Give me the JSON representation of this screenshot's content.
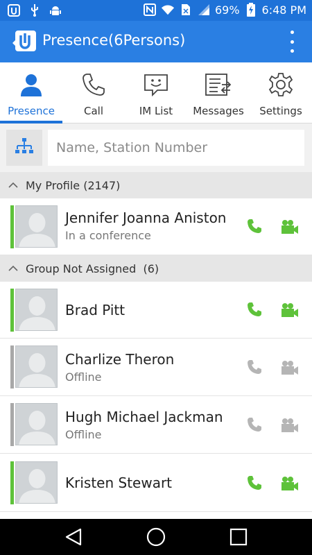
{
  "status_bar": {
    "battery": "69%",
    "time": "6:48 PM",
    "icons": [
      "app-notification-icon",
      "usb-icon",
      "android-debug-icon",
      "nfc-icon",
      "wifi-icon",
      "sim-icon",
      "signal-icon",
      "battery-charging-icon"
    ]
  },
  "app_bar": {
    "title": "Presence(6Persons)",
    "logo_icon": "app-logo-icon",
    "menu_icon": "overflow-menu-icon"
  },
  "tabs": [
    {
      "label": "Presence",
      "icon": "person-icon",
      "active": true
    },
    {
      "label": "Call",
      "icon": "phone-icon",
      "active": false
    },
    {
      "label": "IM List",
      "icon": "chat-icon",
      "active": false
    },
    {
      "label": "Messages",
      "icon": "messages-icon",
      "active": false
    },
    {
      "label": "Settings",
      "icon": "gear-icon",
      "active": false
    }
  ],
  "search": {
    "placeholder": "Name, Station Number",
    "value": "",
    "org_icon": "org-chart-icon"
  },
  "sections": [
    {
      "label": "My Profile (2147)",
      "contacts": [
        {
          "name": "Jennifer Joanna Aniston",
          "status": "In a conference",
          "online": true
        }
      ]
    },
    {
      "label": "Group Not Assigned  (6)",
      "contacts": [
        {
          "name": "Brad Pitt",
          "status": "",
          "online": true
        },
        {
          "name": "Charlize Theron",
          "status": "Offline",
          "online": false
        },
        {
          "name": "Hugh Michael Jackman",
          "status": "Offline",
          "online": false
        },
        {
          "name": "Kristen Stewart",
          "status": "",
          "online": true
        }
      ]
    }
  ],
  "colors": {
    "app_bar": "#2a7fe3",
    "status_bar": "#1e72d8",
    "online": "#5ec23a",
    "offline": "#a8a8a8",
    "active_tab": "#1e72d8"
  },
  "nav": {
    "icons": [
      "back-icon",
      "home-icon",
      "recents-icon"
    ]
  }
}
